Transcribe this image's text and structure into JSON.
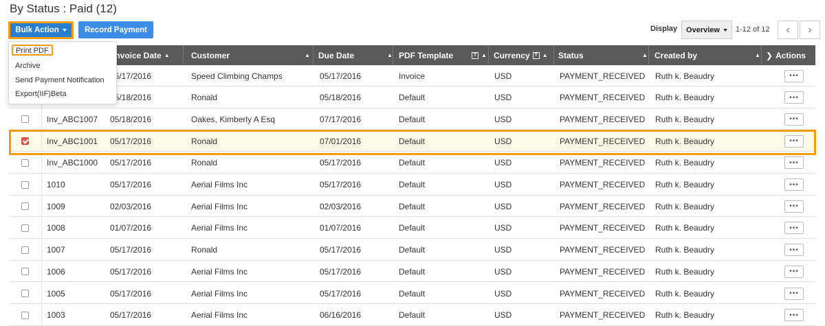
{
  "title": "By Status : Paid (12)",
  "toolbar": {
    "bulk_action_label": "Bulk Action",
    "record_payment_label": "Record Payment",
    "display_label": "Display",
    "display_value": "Overview",
    "range_text": "1-12 of 12",
    "prev_icon": "chevron-left-icon",
    "next_icon": "chevron-right-icon"
  },
  "bulk_menu": {
    "items": [
      "Print PDF",
      "Archive",
      "Send Payment Notification",
      "Export(IIF)Beta"
    ]
  },
  "columns": {
    "invoice_date": "Invoice Date",
    "customer": "Customer",
    "due_date": "Due Date",
    "pdf_template": "PDF Template",
    "currency": "Currency",
    "status": "Status",
    "created_by": "Created by",
    "actions": "Actions"
  },
  "rows": [
    {
      "invoice": "",
      "invoice_date": "05/17/2016",
      "customer": "Speed Climbing Champs",
      "due_date": "05/17/2016",
      "template": "Invoice",
      "currency": "USD",
      "status": "PAYMENT_RECEIVED",
      "created_by": "Ruth k. Beaudry",
      "checked": false
    },
    {
      "invoice": "",
      "invoice_date": "05/18/2016",
      "customer": "Ronald",
      "due_date": "05/18/2016",
      "template": "Default",
      "currency": "USD",
      "status": "PAYMENT_RECEIVED",
      "created_by": "Ruth k. Beaudry",
      "checked": false
    },
    {
      "invoice": "Inv_ABC1007",
      "invoice_date": "05/18/2016",
      "customer": "Oakes, Kimberly A Esq",
      "due_date": "07/17/2016",
      "template": "Default",
      "currency": "USD",
      "status": "PAYMENT_RECEIVED",
      "created_by": "Ruth k. Beaudry",
      "checked": false
    },
    {
      "invoice": "Inv_ABC1001",
      "invoice_date": "05/17/2016",
      "customer": "Ronald",
      "due_date": "07/01/2016",
      "template": "Default",
      "currency": "USD",
      "status": "PAYMENT_RECEIVED",
      "created_by": "Ruth k. Beaudry",
      "checked": true
    },
    {
      "invoice": "Inv_ABC1000",
      "invoice_date": "05/17/2016",
      "customer": "Ronald",
      "due_date": "05/17/2016",
      "template": "Default",
      "currency": "USD",
      "status": "PAYMENT_RECEIVED",
      "created_by": "Ruth k. Beaudry",
      "checked": false
    },
    {
      "invoice": "1010",
      "invoice_date": "05/17/2016",
      "customer": "Aerial Films Inc",
      "due_date": "05/17/2016",
      "template": "Default",
      "currency": "USD",
      "status": "PAYMENT_RECEIVED",
      "created_by": "Ruth k. Beaudry",
      "checked": false
    },
    {
      "invoice": "1009",
      "invoice_date": "02/03/2016",
      "customer": "Aerial Films Inc",
      "due_date": "02/03/2016",
      "template": "Default",
      "currency": "USD",
      "status": "PAYMENT_RECEIVED",
      "created_by": "Ruth k. Beaudry",
      "checked": false
    },
    {
      "invoice": "1008",
      "invoice_date": "01/07/2016",
      "customer": "Aerial Films Inc",
      "due_date": "01/07/2016",
      "template": "Default",
      "currency": "USD",
      "status": "PAYMENT_RECEIVED",
      "created_by": "Ruth k. Beaudry",
      "checked": false
    },
    {
      "invoice": "1007",
      "invoice_date": "05/17/2016",
      "customer": "Ronald",
      "due_date": "05/17/2016",
      "template": "Default",
      "currency": "USD",
      "status": "PAYMENT_RECEIVED",
      "created_by": "Ruth k. Beaudry",
      "checked": false
    },
    {
      "invoice": "1006",
      "invoice_date": "05/17/2016",
      "customer": "Aerial Films Inc",
      "due_date": "05/17/2016",
      "template": "Default",
      "currency": "USD",
      "status": "PAYMENT_RECEIVED",
      "created_by": "Ruth k. Beaudry",
      "checked": false
    },
    {
      "invoice": "1005",
      "invoice_date": "05/17/2016",
      "customer": "Aerial Films Inc",
      "due_date": "05/17/2016",
      "template": "Default",
      "currency": "USD",
      "status": "PAYMENT_RECEIVED",
      "created_by": "Ruth k. Beaudry",
      "checked": false
    },
    {
      "invoice": "1003",
      "invoice_date": "05/17/2016",
      "customer": "Aerial Films Inc",
      "due_date": "06/16/2016",
      "template": "Default",
      "currency": "USD",
      "status": "PAYMENT_RECEIVED",
      "created_by": "Ruth k. Beaudry",
      "checked": false
    }
  ],
  "colors": {
    "accent": "#2a7ed0",
    "highlight_outline": "#f39c12",
    "header_bg": "#5a5a5a",
    "selected_row_bg": "#fbfce8"
  }
}
